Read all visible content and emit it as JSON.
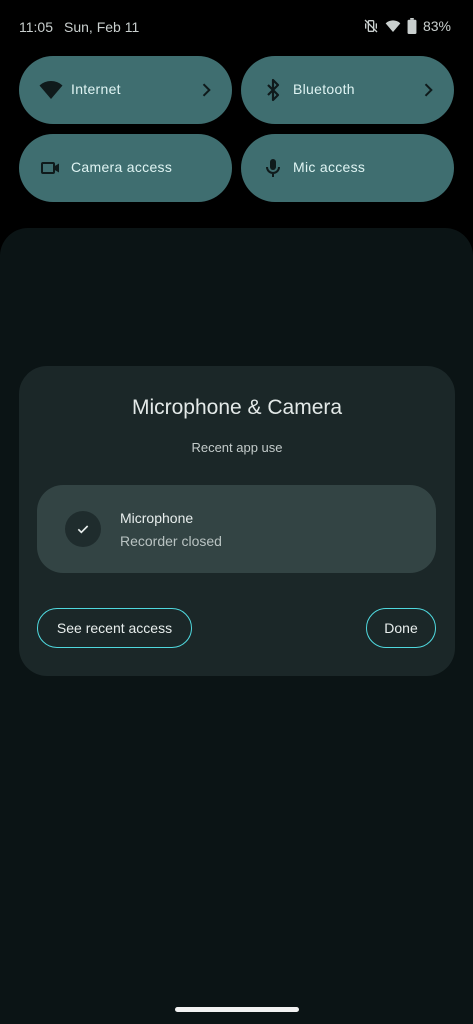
{
  "status_bar": {
    "time": "11:05",
    "date": "Sun, Feb 11",
    "battery": "83%",
    "icons": [
      "vibrate-off-icon",
      "wifi-icon",
      "battery-icon"
    ]
  },
  "quick_tiles": [
    {
      "label": "Internet",
      "icon": "wifi-icon",
      "has_chevron": true
    },
    {
      "label": "Bluetooth",
      "icon": "bluetooth-icon",
      "has_chevron": true
    },
    {
      "label": "Camera access",
      "icon": "camera-icon",
      "has_chevron": false
    },
    {
      "label": "Mic access",
      "icon": "microphone-icon",
      "has_chevron": false
    }
  ],
  "dialog": {
    "title": "Microphone & Camera",
    "subtitle": "Recent app use",
    "usage": {
      "title": "Microphone",
      "detail": "Recorder closed",
      "icon": "check-icon"
    },
    "buttons": {
      "recent": "See recent access",
      "done": "Done"
    }
  },
  "colors": {
    "tile_bg": "#3f6e70",
    "shade_bg": "#0b1415",
    "dialog_bg": "#1b2728",
    "card_bg": "#334444",
    "button_outline": "#4fd8de"
  }
}
